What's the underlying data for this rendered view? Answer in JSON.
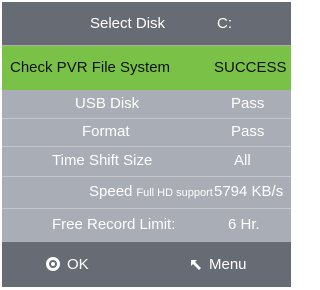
{
  "header": {
    "label": "Select Disk",
    "value": "C:"
  },
  "check": {
    "label": "Check PVR File System",
    "value": "SUCCESS"
  },
  "usb": {
    "label": "USB Disk",
    "value": "Pass"
  },
  "format": {
    "label": "Format",
    "value": "Pass"
  },
  "time_shift": {
    "label": "Time Shift Size",
    "value": "All"
  },
  "speed": {
    "label": "Speed",
    "note": "Full HD support",
    "value": "5794 KB/s"
  },
  "free_limit": {
    "label": "Free Record Limit:",
    "value": "6 Hr."
  },
  "footer": {
    "ok_label": "OK",
    "menu_label": "Menu"
  },
  "colors": {
    "header_bg": "#676b73",
    "highlight_bg": "#7ac247",
    "panel_bg": "#a9adb5"
  },
  "icons": {
    "ok": "ok-button-icon",
    "menu": "back-arrow-icon"
  }
}
